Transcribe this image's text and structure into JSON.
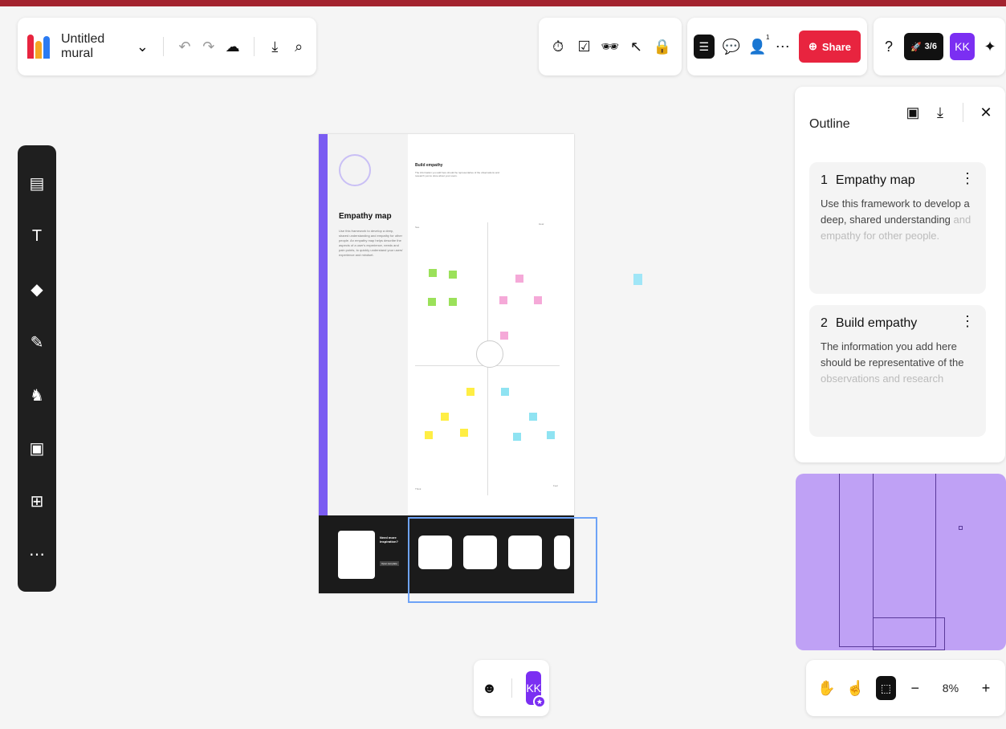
{
  "app": {
    "title": "Untitled mural"
  },
  "toolbar": {
    "share_label": "Share",
    "collaborators_count": "1",
    "progress_label": "3/6",
    "avatar_initials": "KK"
  },
  "outline": {
    "title": "Outline",
    "items": [
      {
        "number": "1",
        "title": "Empathy map",
        "description": "Use this framework to develop a deep, shared understanding",
        "description_faded": "and empathy for other people."
      },
      {
        "number": "2",
        "title": "Build empathy",
        "description": "The information you add here should be representative of the",
        "description_faded": "observations and research"
      }
    ]
  },
  "canvas": {
    "template_title": "Empathy map",
    "template_desc": "Use this framework to develop a deep, shared understanding and empathy for other people. An empathy map helps describe the aspects of a user's experience, needs and pain points, to quickly understand your users' experience and mindset.",
    "step_title": "Build empathy",
    "step_desc": "The information you add here should be representative of the observations and research you've done about your users.",
    "section_see": "See",
    "section_hear": "Hear",
    "section_think": "Think",
    "section_feel": "Feel",
    "promo_title": "Need more inspiration?",
    "promo_button": "Open template"
  },
  "zoom": {
    "level": "8%"
  },
  "colors": {
    "accent": "#7b2ff2",
    "share": "#e8243f",
    "topline": "#a3232f",
    "minimap": "#bfa1f5"
  }
}
